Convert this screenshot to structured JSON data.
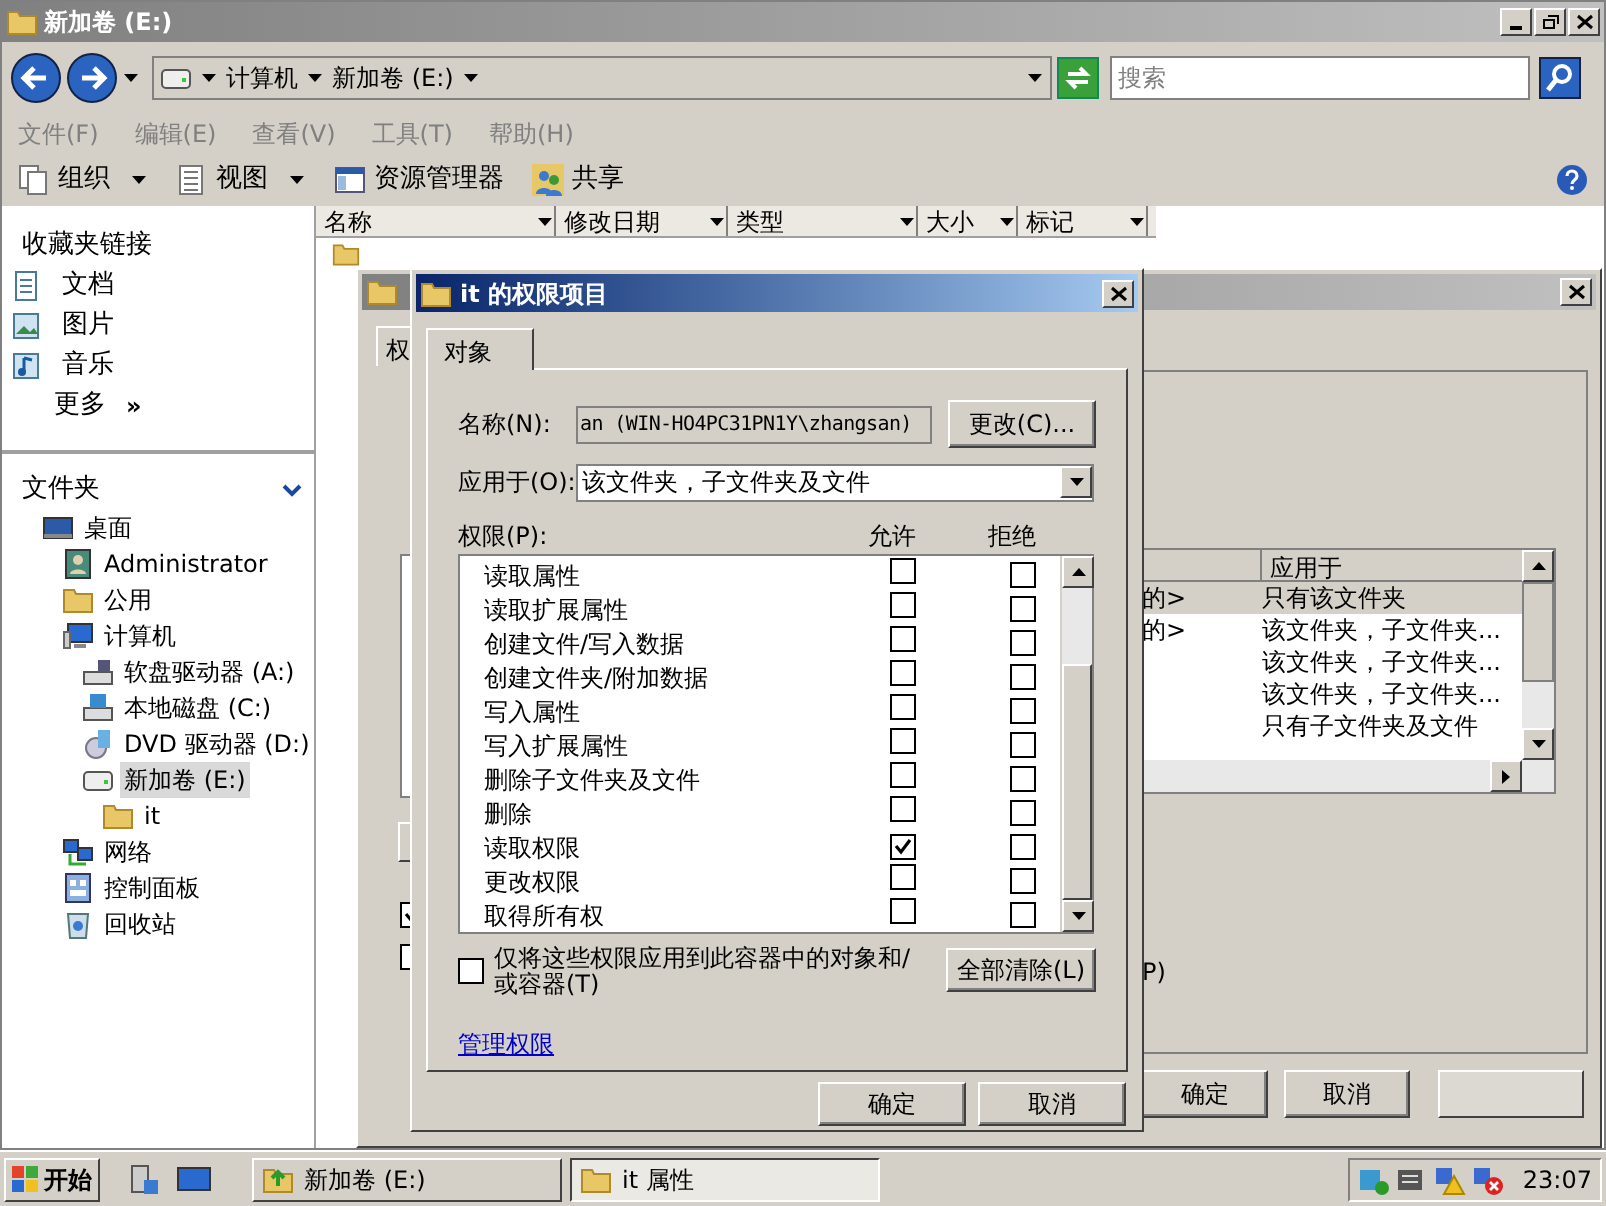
{
  "explorer": {
    "title": "新加卷 (E:)",
    "breadcrumb": [
      "计算机",
      "新加卷 (E:)"
    ],
    "search": {
      "placeholder": "搜索"
    },
    "menu": [
      "文件(F)",
      "编辑(E)",
      "查看(V)",
      "工具(T)",
      "帮助(H)"
    ],
    "toolbar": [
      {
        "label": "组织",
        "kind": "organize",
        "dropdown": true
      },
      {
        "label": "视图",
        "kind": "views",
        "dropdown": true
      },
      {
        "label": "资源管理器",
        "kind": "explorer",
        "dropdown": false
      },
      {
        "label": "共享",
        "kind": "share",
        "dropdown": false
      }
    ],
    "favorites": {
      "title": "收藏夹链接",
      "items": [
        {
          "label": "文档",
          "kind": "documents"
        },
        {
          "label": "图片",
          "kind": "pictures"
        },
        {
          "label": "音乐",
          "kind": "music"
        }
      ],
      "more": "更多",
      "more_glyph": "»"
    },
    "folders": {
      "title": "文件夹",
      "tree": [
        {
          "label": "桌面",
          "kind": "desktop",
          "selected": false,
          "children": [
            {
              "label": "Administrator",
              "kind": "user",
              "selected": false
            },
            {
              "label": "公用",
              "kind": "folder",
              "selected": false
            },
            {
              "label": "计算机",
              "kind": "computer",
              "selected": false,
              "children": [
                {
                  "label": "软盘驱动器 (A:)",
                  "kind": "floppy",
                  "selected": false
                },
                {
                  "label": "本地磁盘 (C:)",
                  "kind": "disk",
                  "selected": false
                },
                {
                  "label": "DVD 驱动器 (D:)",
                  "kind": "dvd",
                  "selected": false
                },
                {
                  "label": "新加卷 (E:)",
                  "kind": "drive",
                  "selected": true,
                  "children": [
                    {
                      "label": "it",
                      "kind": "folder",
                      "selected": false
                    }
                  ]
                }
              ]
            },
            {
              "label": "网络",
              "kind": "network",
              "selected": false
            },
            {
              "label": "控制面板",
              "kind": "control",
              "selected": false
            },
            {
              "label": "回收站",
              "kind": "recycle",
              "selected": false
            }
          ]
        }
      ]
    },
    "columns": [
      "名称",
      "修改日期",
      "类型",
      "大小",
      "标记"
    ]
  },
  "advanced": {
    "tab": "权",
    "checkboxes": [
      {
        "checked": true
      },
      {
        "checked": false
      }
    ],
    "checkbox_tail": "P)",
    "list": {
      "header": "应用于",
      "rows": [
        {
          "column_1": "的>",
          "applies_to": "只有该文件夹",
          "selected": true
        },
        {
          "column_1": "的>",
          "applies_to": "该文件夹，子文件夹...",
          "selected": false
        },
        {
          "applies_to": "该文件夹，子文件夹...",
          "selected": false
        },
        {
          "applies_to": "该文件夹，子文件夹...",
          "selected": false
        },
        {
          "applies_to": "只有子文件夹及文件",
          "selected": false
        }
      ]
    },
    "buttons": [
      "确定",
      "取消"
    ],
    "apply_button": {
      "disabled": true
    }
  },
  "dialog": {
    "title": "it 的权限项目",
    "tabs": [
      {
        "label": "对象",
        "selected": true
      }
    ],
    "name_label": "名称(N):",
    "name_value": "an (WIN-HO4PC31PN1Y\\zhangsan)",
    "change_button": "更改(C)...",
    "apply_label": "应用于(O):",
    "apply_value": "该文件夹，子文件夹及文件",
    "permissions_label": "权限(P):",
    "allow_header": "允许",
    "deny_header": "拒绝",
    "permissions": [
      {
        "name": "读取属性",
        "allow": false,
        "deny": false
      },
      {
        "name": "读取扩展属性",
        "allow": false,
        "deny": false
      },
      {
        "name": "创建文件/写入数据",
        "allow": false,
        "deny": false
      },
      {
        "name": "创建文件夹/附加数据",
        "allow": false,
        "deny": false
      },
      {
        "name": "写入属性",
        "allow": false,
        "deny": false
      },
      {
        "name": "写入扩展属性",
        "allow": false,
        "deny": false
      },
      {
        "name": "删除子文件夹及文件",
        "allow": false,
        "deny": false
      },
      {
        "name": "删除",
        "allow": false,
        "deny": false
      },
      {
        "name": "读取权限",
        "allow": true,
        "deny": false
      },
      {
        "name": "更改权限",
        "allow": false,
        "deny": false
      },
      {
        "name": "取得所有权",
        "allow": false,
        "deny": false
      }
    ],
    "only_container": {
      "label": "仅将这些权限应用到此容器中的对象和/或容器(T)",
      "checked": false
    },
    "clear_button": "全部清除(L)",
    "manage_link": "管理权限",
    "buttons": [
      "确定",
      "取消"
    ]
  },
  "taskbar": {
    "start": "开始",
    "tasks": [
      {
        "label": "新加卷 (E:)",
        "kind": "explorer",
        "selected": false
      },
      {
        "label": "it 属性",
        "kind": "folder",
        "selected": true
      }
    ],
    "clock": "23:07"
  }
}
